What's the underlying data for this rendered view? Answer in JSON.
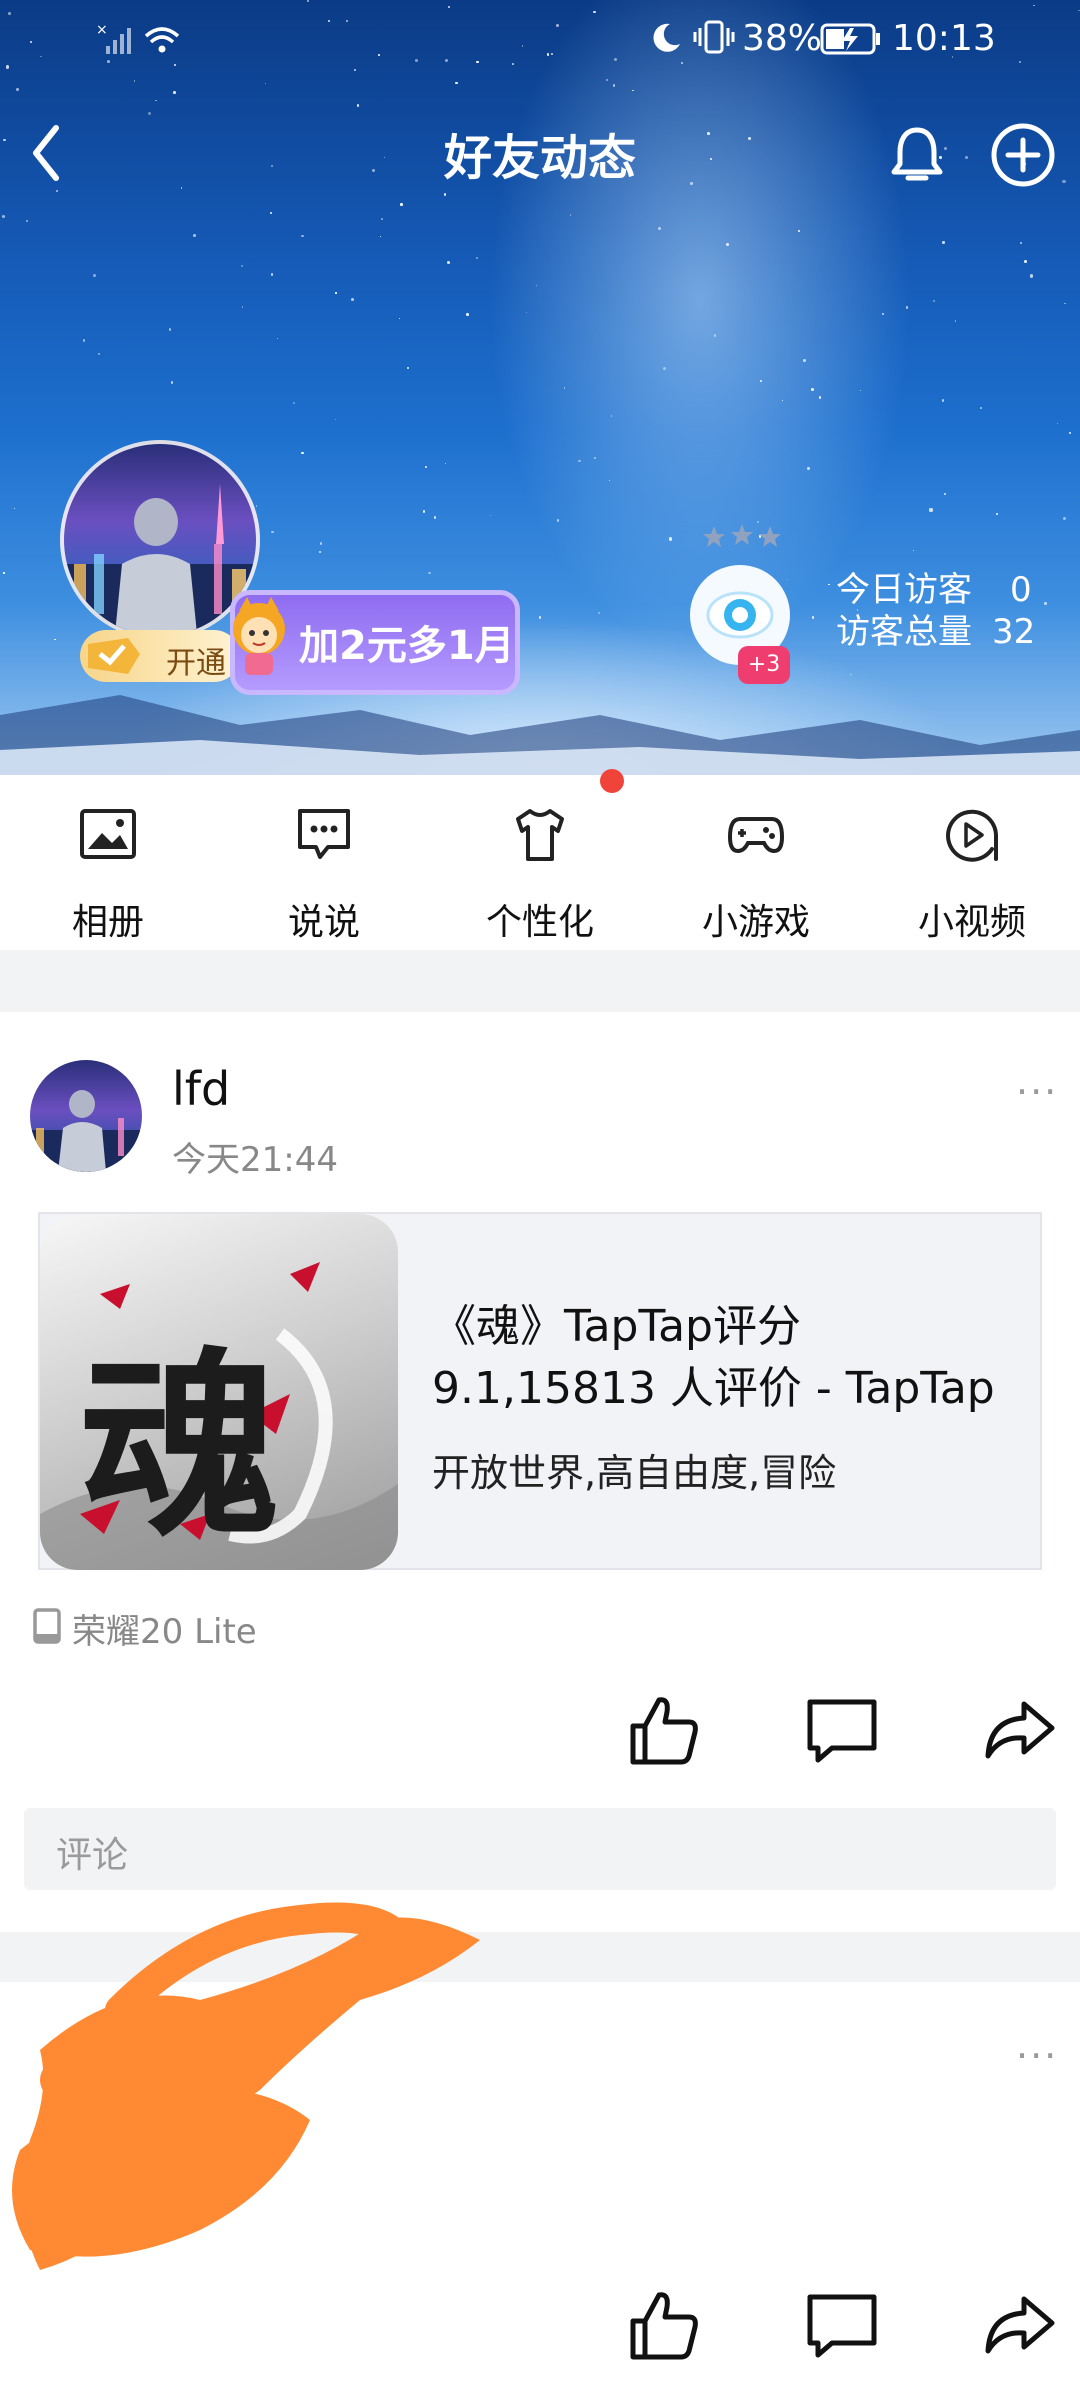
{
  "status_bar": {
    "battery": "38%",
    "time": "10:13"
  },
  "nav": {
    "title": "好友动态"
  },
  "profile": {
    "vip_open_label": "开通",
    "vip_promo": "加2元多1月",
    "visitor_badge": "+3",
    "today_visitors_label": "今日访客",
    "today_visitors_value": "0",
    "total_visitors_label": "访客总量",
    "total_visitors_value": "32"
  },
  "quick_actions": [
    {
      "label": "相册",
      "icon": "photo-album-icon"
    },
    {
      "label": "说说",
      "icon": "chat-bubble-icon"
    },
    {
      "label": "个性化",
      "icon": "tshirt-icon",
      "dot": true
    },
    {
      "label": "小游戏",
      "icon": "gamepad-icon"
    },
    {
      "label": "小视频",
      "icon": "play-circle-icon"
    }
  ],
  "post": {
    "author": "lfd",
    "time": "今天21:44",
    "more": "···",
    "card": {
      "title_line1": "《魂》TapTap评分",
      "title_line2": "9.1,15813 人评价 - TapTap",
      "description": "开放世界,高自由度,冒险",
      "image_text": "魂"
    },
    "device": "荣耀20 Lite",
    "comment_placeholder": "评论"
  },
  "post2": {
    "more": "···"
  },
  "colors": {
    "accent_red": "#f0443b",
    "badge_pink": "#ef3d6f",
    "scribble_orange": "#ff8a33"
  }
}
